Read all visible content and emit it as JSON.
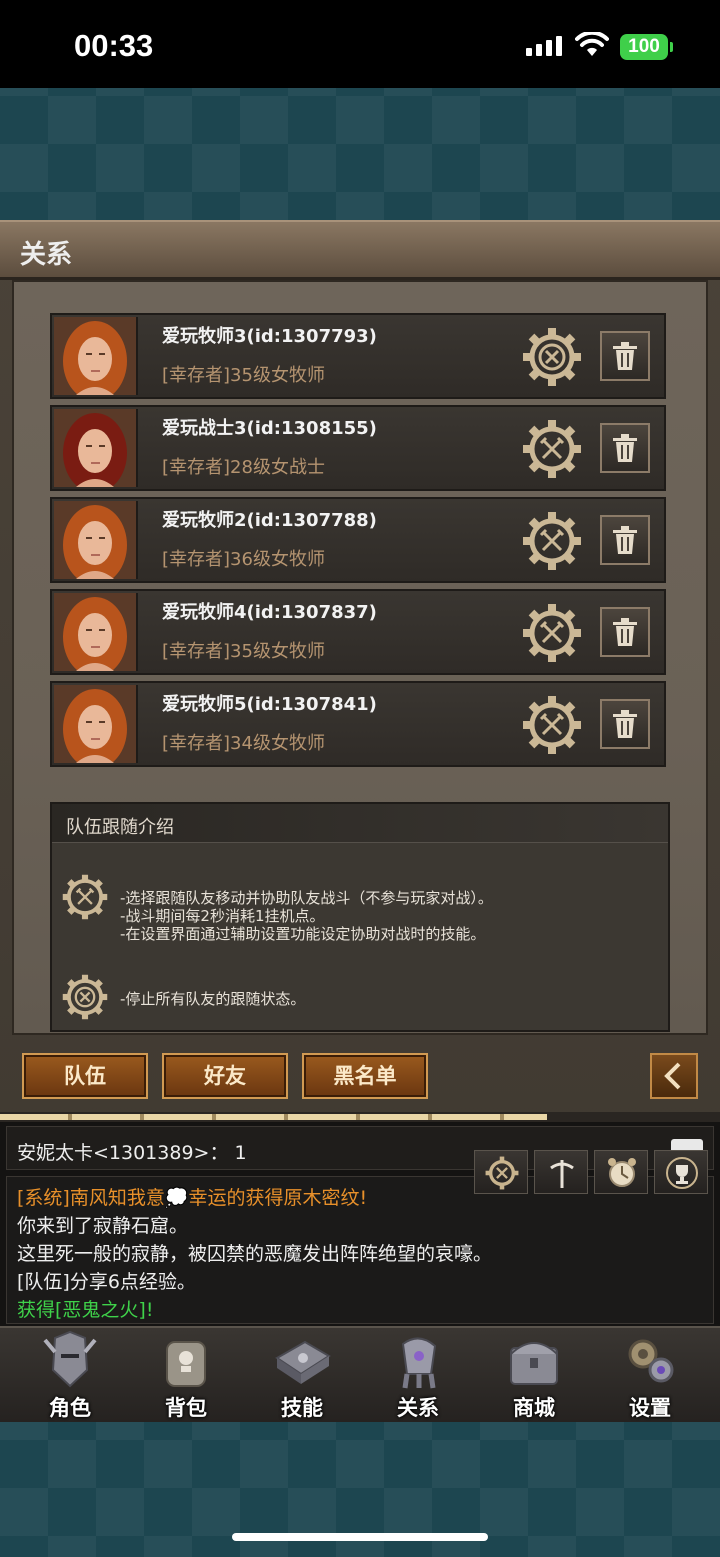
{
  "status": {
    "time": "00:33",
    "battery": "100"
  },
  "panel": {
    "title": "关系"
  },
  "friends": [
    {
      "name": "爱玩牧师3(id:1307793)",
      "info": "[幸存者]35级女牧师",
      "follow_icon": "stop-follow-gear-icon"
    },
    {
      "name": "爱玩战士3(id:1308155)",
      "info": "[幸存者]28级女战士",
      "follow_icon": "follow-gear-icon"
    },
    {
      "name": "爱玩牧师2(id:1307788)",
      "info": "[幸存者]36级女牧师",
      "follow_icon": "follow-gear-icon"
    },
    {
      "name": "爱玩牧师4(id:1307837)",
      "info": "[幸存者]35级女牧师",
      "follow_icon": "follow-gear-icon"
    },
    {
      "name": "爱玩牧师5(id:1307841)",
      "info": "[幸存者]34级女牧师",
      "follow_icon": "follow-gear-icon"
    }
  ],
  "intro": {
    "title": "队伍跟随介绍",
    "follow_text": "-选择跟随队友移动并协助队友战斗（不参与玩家对战）。\n-战斗期间每2秒消耗1挂机点。\n-在设置界面通过辅助设置功能设定协助对战时的技能。",
    "stop_text": "-停止所有队友的跟随状态。"
  },
  "tabs": {
    "team": "队伍",
    "friends": "好友",
    "blacklist": "黑名单"
  },
  "chat": {
    "input_text": "安妮太卡<1301389>：  1",
    "lines": [
      {
        "text": "[系统]南风知我意💭幸运的获得原木密纹!",
        "color": "#e8902a"
      },
      {
        "text": "你来到了寂静石窟。",
        "color": "#eeeeee"
      },
      {
        "text": "这里死一般的寂静，被囚禁的恶魔发出阵阵绝望的哀嚎。",
        "color": "#eeeeee"
      },
      {
        "text": "[队伍]分享6点经验。",
        "color": "#eeeeee"
      },
      {
        "text": "获得[恶鬼之火]!",
        "color": "#3fd24a"
      }
    ]
  },
  "nav": {
    "items": [
      {
        "label": "角色",
        "icon": "helmet-icon"
      },
      {
        "label": "背包",
        "icon": "backpack-icon"
      },
      {
        "label": "技能",
        "icon": "skill-book-icon"
      },
      {
        "label": "关系",
        "icon": "gauntlet-icon"
      },
      {
        "label": "商城",
        "icon": "treasure-chest-icon"
      },
      {
        "label": "设置",
        "icon": "gears-icon"
      }
    ]
  },
  "progress": {
    "filled_fraction": 0.76
  },
  "colors": {
    "name": "#f2f2f2",
    "info": "#b59470",
    "tab_bg": "#8a4c18",
    "system_msg": "#e8902a",
    "loot_msg": "#3fd24a"
  }
}
